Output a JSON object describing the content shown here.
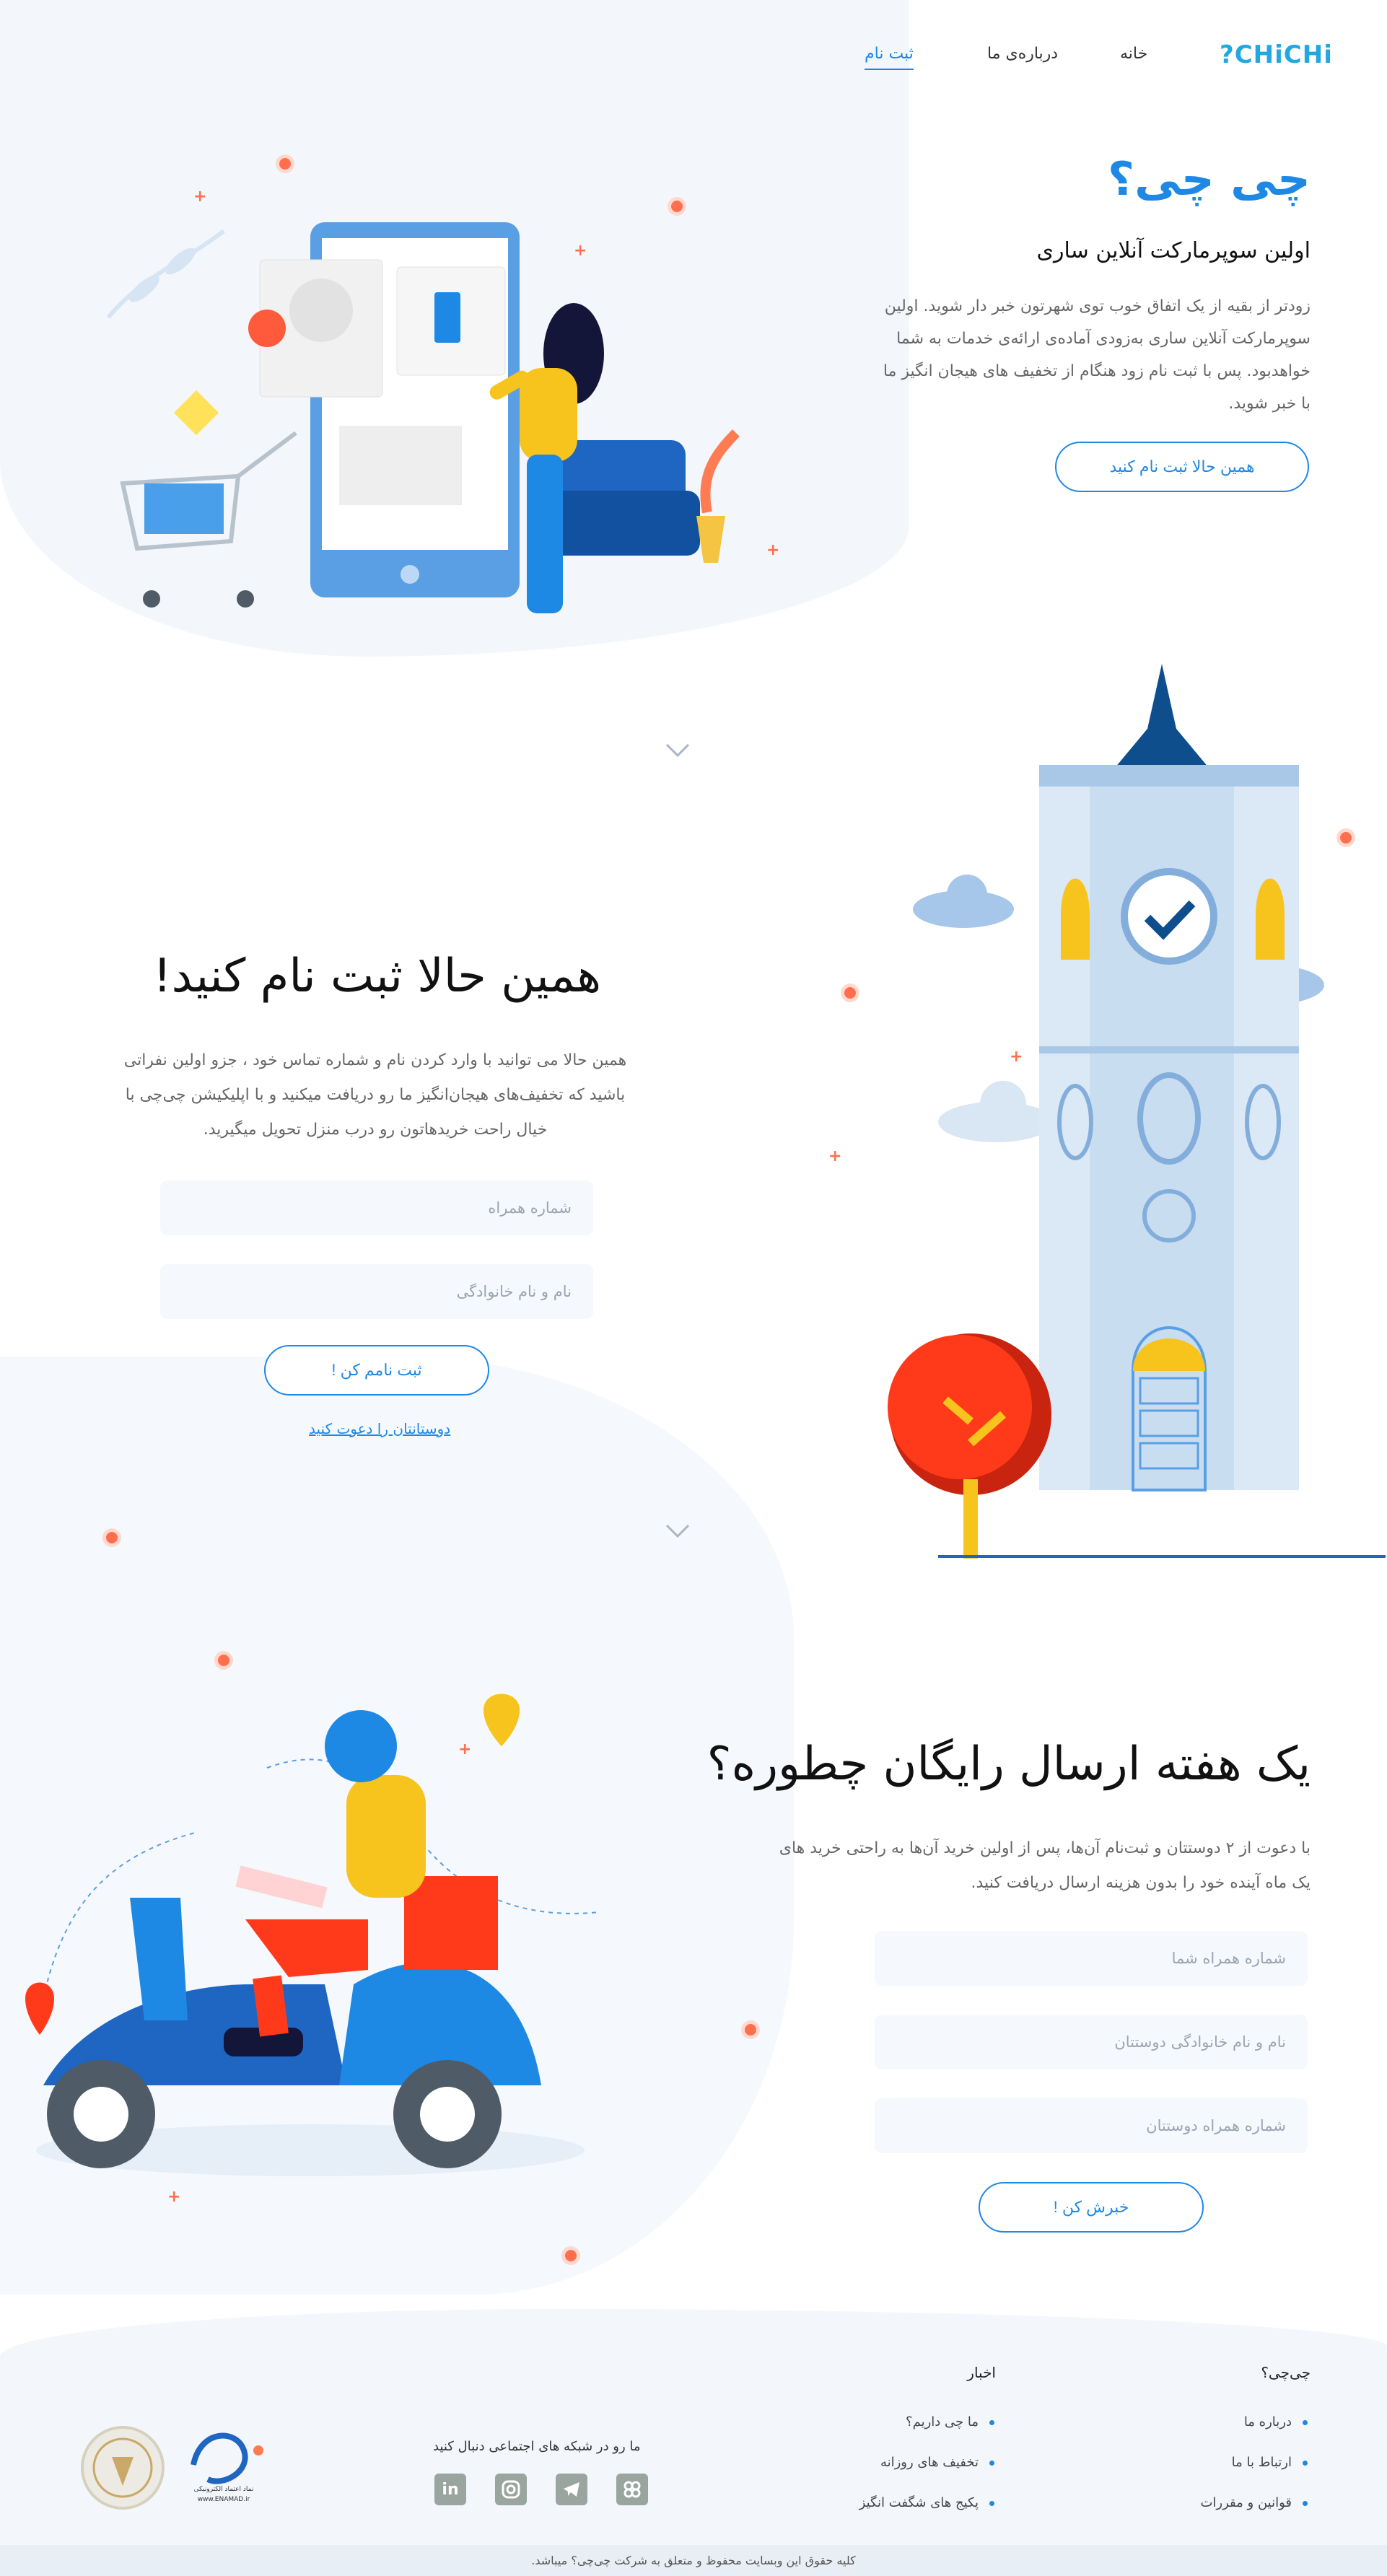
{
  "header": {
    "logo": "CHiCHi?",
    "nav": [
      "خانه",
      "درباره‌ی ما",
      "ثبت نام"
    ]
  },
  "hero": {
    "title": "چی چی؟",
    "subtitle": "اولین سوپرمارکت آنلاین ساری",
    "description": "زودتر از بقیه از یک اتفاق خوب توی شهرتون خبر دار شوید. اولین سوپرمارکت آنلاین ساری به‌زودی آماده‌ی ارائه‌ی خدمات به شما خواهدبود. پس با ثبت نام زود هنگام از تخفیف های هیجان انگیز ما با خبر شوید.",
    "cta": "همین حالا ثبت نام کنید"
  },
  "register": {
    "title": "همین حالا ثبت نام کنید!",
    "description": "همین حالا می توانید با وارد کردن نام و شماره تماس خود ، جزو اولین نفراتی باشید که تخفیف‌های هیجان‌انگیز ما رو دریافت میکنید و با اپلیکیشن چی‌چی با خیال راحت خریدهاتون رو درب منزل تحویل میگیرید.",
    "phone_placeholder": "شماره همراه",
    "name_placeholder": "نام و نام خانوادگی",
    "submit": "ثبت نامم کن !",
    "invite_link": "دوستانتان را دعوت کنید"
  },
  "referral": {
    "title": "یک هفته ارسال رایگان چطوره؟",
    "description": "با دعوت از ۲ دوستتان و ثبت‌نام آن‌ها، پس از اولین خرید آن‌ها به راحتی خرید های یک ماه آینده خود را بدون هزینه ارسال دریافت کنید.",
    "my_phone_placeholder": "شماره همراه شما",
    "friend_name_placeholder": "نام و نام خانوادگی دوستتان",
    "friend_phone_placeholder": "شماره همراه دوستتان",
    "submit": "خبرش کن !"
  },
  "footer": {
    "col1_title": "چی‌چی؟",
    "col1_items": [
      "درباره ما",
      "ارتباط با ما",
      "قوانین و مقررات"
    ],
    "col2_title": "اخبار",
    "col2_items": [
      "ما چی داریم؟",
      "تخفیف های روزانه",
      "پکیج های شگفت انگیز"
    ],
    "social_title": "ما رو در شبکه های اجتماعی دنبال کنید",
    "social_icons": [
      "linkedin-icon",
      "instagram-icon",
      "telegram-icon",
      "app-icon"
    ],
    "enamad_text": "نماد اعتماد الکترونیکی",
    "enamad_url_text": "www.ENAMAD.ir",
    "copyright": "کلیه حقوق این وبسایت محفوظ و متعلق به شرکت چی‌چی؟ میباشد."
  },
  "colors": {
    "primary": "#1e88e5",
    "accent": "#ff6f4d",
    "background_soft": "#f3f7fc"
  }
}
